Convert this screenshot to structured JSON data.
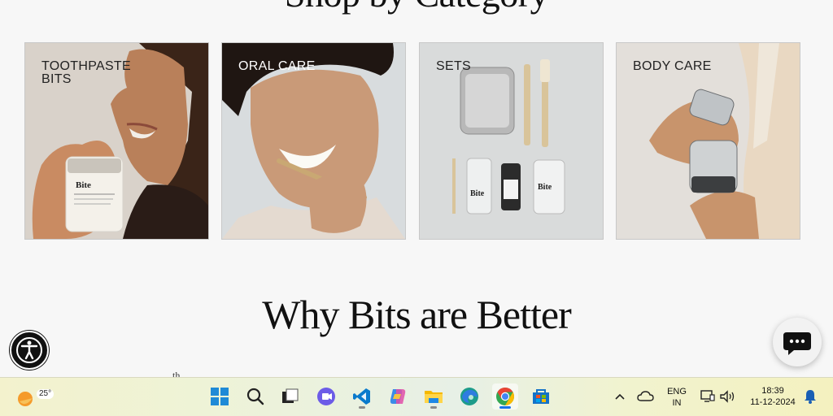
{
  "page": {
    "cut_heading": "Shop by Category"
  },
  "cards": [
    {
      "label": "TOOTHPASTE BITS",
      "label_color": "#222222"
    },
    {
      "label": "ORAL CARE",
      "label_color": "#ffffff"
    },
    {
      "label": "SETS",
      "label_color": "#222222"
    },
    {
      "label": "BODY CARE",
      "label_color": "#222222"
    }
  ],
  "jar_labels": {
    "brand": "Bite"
  },
  "section": {
    "title": "Why Bits are Better",
    "peek_text": "th"
  },
  "widgets": {
    "accessibility_icon": "accessibility-icon",
    "chat_icon": "chat-bubble-icon"
  },
  "taskbar": {
    "weather_temp": "25°",
    "apps": [
      "start",
      "search",
      "task-view",
      "meet",
      "vscode",
      "copilot",
      "file-explorer",
      "edge",
      "chrome",
      "store"
    ],
    "active_app": "chrome",
    "language_line1": "ENG",
    "language_line2": "IN",
    "time": "18:39",
    "date": "11-12-2024"
  },
  "colors": {
    "background": "#f7f7f7",
    "text": "#111111",
    "taskbar_accent": "#1a73e8"
  }
}
